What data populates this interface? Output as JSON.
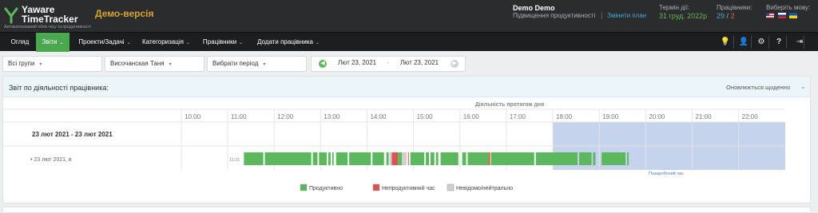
{
  "header": {
    "logo_line1": "Yaware",
    "logo_line2": "TimeTracker",
    "logo_sub": "Автоматизований облік часу та продуктивності",
    "demo_label": "Демо-версія",
    "account_name": "Demo Demo",
    "upgrade_label": "Підвищення продуктивності",
    "separator": "|",
    "change_plan_label": "Змінити план",
    "term_label": "Термін дії:",
    "term_value": "31 груд. 2022р",
    "employees_label": "Працівники:",
    "employees_active": "29",
    "employees_slash": "/",
    "employees_other": "2",
    "language_label": "Виберіть мову:",
    "flags": [
      "flag-us-icon",
      "flag-ru-icon",
      "flag-ua-icon"
    ]
  },
  "nav": {
    "items": [
      {
        "label": "Огляд",
        "has_caret": false
      },
      {
        "label": "Звіти",
        "has_caret": true,
        "active": true
      },
      {
        "label": "Проекти/Задачі",
        "has_caret": true
      },
      {
        "label": "Категоризація",
        "has_caret": true
      },
      {
        "label": "Працівники",
        "has_caret": true
      },
      {
        "label": "Додати працівника",
        "has_caret": true
      }
    ],
    "caret": "⌄",
    "right_icons": [
      "lightbulb-icon",
      "user-icon",
      "gear-icon",
      "help-icon",
      "logout-icon"
    ],
    "right_glyphs": [
      "💡",
      "👤",
      "⚙",
      "?",
      "⇥"
    ]
  },
  "filters": {
    "groups": "Всі групи",
    "employee": "Височанская Таня",
    "period": "Вибрати період",
    "caret": "▾",
    "date_from": "Лют 23, 2021",
    "date_dash": "-",
    "date_to": "Лют 23, 2021",
    "prev_glyph": "◀",
    "next_glyph": "▶"
  },
  "panel": {
    "title": "Звіт по діяльності працівника:",
    "update_label": "Оновлюється щоденно",
    "chevron": "⌄"
  },
  "chart_data": {
    "type": "timeline",
    "header_label": "Діяльність протягом дня",
    "hours": [
      "10:00",
      "11:00",
      "12:00",
      "13:00",
      "14:00",
      "15:00",
      "16:00",
      "17:00",
      "18:00",
      "19:00",
      "20:00",
      "21:00",
      "22:00"
    ],
    "range_label": "23 лют 2021 - 23 лют 2021",
    "row_label": "• 23 лют 2021, в",
    "start_label": "11:21",
    "off_hours_label": "Позаробочий час",
    "off_hours_from": "18:00",
    "colors": {
      "productive": "#5cb85c",
      "unproductive": "#d9534f",
      "neutral": "#cfcfcf",
      "off_hours": "#c5d3ec"
    },
    "segments": [
      {
        "start": "11:21",
        "end": "11:46",
        "category": "productive"
      },
      {
        "start": "11:48",
        "end": "12:48",
        "category": "productive"
      },
      {
        "start": "12:50",
        "end": "12:56",
        "category": "productive"
      },
      {
        "start": "12:58",
        "end": "13:08",
        "category": "productive"
      },
      {
        "start": "13:10",
        "end": "13:13",
        "category": "productive"
      },
      {
        "start": "13:15",
        "end": "13:17",
        "category": "productive"
      },
      {
        "start": "13:20",
        "end": "13:35",
        "category": "productive"
      },
      {
        "start": "13:37",
        "end": "14:05",
        "category": "productive"
      },
      {
        "start": "14:07",
        "end": "14:22",
        "category": "productive"
      },
      {
        "start": "14:25",
        "end": "14:28",
        "category": "productive"
      },
      {
        "start": "14:29",
        "end": "14:32",
        "category": "neutral"
      },
      {
        "start": "14:32",
        "end": "14:40",
        "category": "unproductive"
      },
      {
        "start": "14:40",
        "end": "14:45",
        "category": "productive"
      },
      {
        "start": "14:45",
        "end": "14:51",
        "category": "neutral"
      },
      {
        "start": "14:53",
        "end": "14:54",
        "category": "unproductive"
      },
      {
        "start": "14:56",
        "end": "15:14",
        "category": "productive"
      },
      {
        "start": "15:16",
        "end": "15:20",
        "category": "productive"
      },
      {
        "start": "15:22",
        "end": "15:27",
        "category": "productive"
      },
      {
        "start": "15:29",
        "end": "15:32",
        "category": "productive"
      },
      {
        "start": "15:35",
        "end": "15:58",
        "category": "productive"
      },
      {
        "start": "16:03",
        "end": "16:08",
        "category": "productive"
      },
      {
        "start": "16:10",
        "end": "16:37",
        "category": "productive"
      },
      {
        "start": "16:37",
        "end": "16:39",
        "category": "unproductive"
      },
      {
        "start": "16:40",
        "end": "17:36",
        "category": "productive"
      },
      {
        "start": "17:38",
        "end": "18:32",
        "category": "productive"
      },
      {
        "start": "18:34",
        "end": "18:50",
        "category": "productive"
      },
      {
        "start": "18:52",
        "end": "18:55",
        "category": "productive"
      },
      {
        "start": "19:03",
        "end": "19:34",
        "category": "productive"
      },
      {
        "start": "19:36",
        "end": "19:38",
        "category": "productive"
      }
    ],
    "legend": [
      {
        "label": "Продуктивно",
        "category": "productive"
      },
      {
        "label": "Непродуктивний час",
        "category": "unproductive"
      },
      {
        "label": "Невідомо/нейтрально",
        "category": "neutral"
      }
    ]
  }
}
